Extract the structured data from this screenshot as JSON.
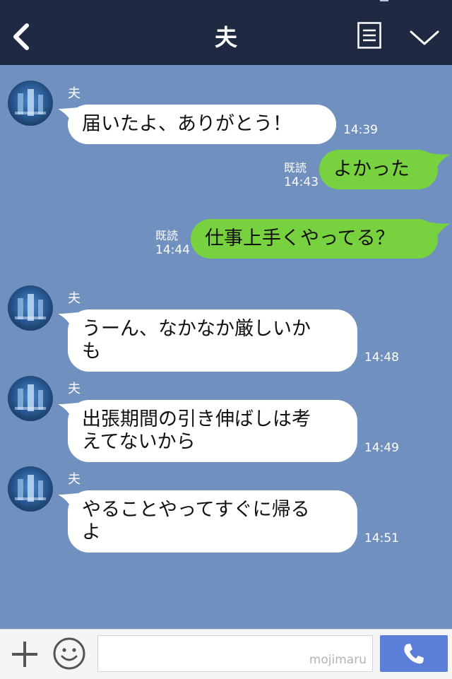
{
  "header": {
    "title": "夫"
  },
  "messages": [
    {
      "sender": "夫",
      "text": "届いたよ、ありがとう！",
      "time": "14:39"
    },
    {
      "read": "既読",
      "text": "よかった",
      "time": "14:43"
    },
    {
      "read": "既読",
      "text": "仕事上手くやってる？",
      "time": "14:44"
    },
    {
      "sender": "夫",
      "line1": "うーん、なかなか厳しいか",
      "line2": "も",
      "time": "14:48"
    },
    {
      "sender": "夫",
      "line1": "出張期間の引き伸ばしは考",
      "line2": "えてないから",
      "time": "14:49"
    },
    {
      "sender": "夫",
      "line1": "やることやってすぐに帰る",
      "line2": "よ",
      "time": "14:51"
    }
  ],
  "footer": {
    "input_watermark": "mojimaru"
  },
  "icons": {
    "back": "chevron-left-icon",
    "menu": "list-icon",
    "collapse": "chevron-down-icon",
    "add": "plus-icon",
    "sticker": "smiley-icon",
    "call": "phone-icon"
  },
  "colors": {
    "header": "#1f2a42",
    "chat_bg": "#7090bf",
    "outgoing": "#78d13e",
    "incoming": "#ffffff",
    "call_button": "#5b7fd8"
  }
}
